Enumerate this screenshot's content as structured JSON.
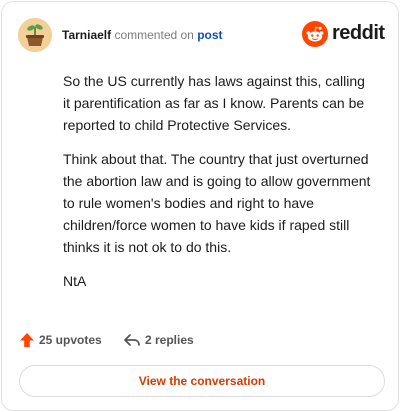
{
  "header": {
    "author": "Tarniaelf",
    "action": "commented on",
    "target": "post",
    "logo_text": "reddit",
    "avatar_icon": "sprout-pot-avatar-icon",
    "logo_icon": "reddit-alien-icon"
  },
  "comment": {
    "paragraphs": [
      "So the US currently has laws against this, calling it parentification as far as I know. Parents can be reported to child Protective Services.",
      "Think about that. The country that just overturned the abortion law and is going to allow government to rule women's bodies and right to have children/force women to have kids if raped still thinks it is not ok to do this.",
      "NtA"
    ]
  },
  "actions": {
    "upvotes": "25 upvotes",
    "replies": "2 replies",
    "upvote_icon": "upvote-arrow-icon",
    "reply_icon": "reply-arrow-icon"
  },
  "cta": {
    "label": "View the conversation"
  },
  "colors": {
    "accent": "#ff4500",
    "link": "#0f4fb3",
    "cta_text": "#d93a00",
    "border": "#e2e2e2"
  }
}
